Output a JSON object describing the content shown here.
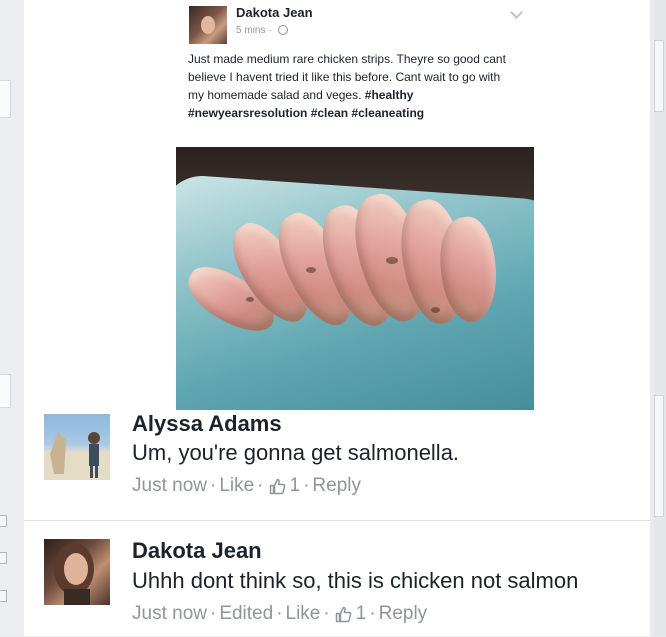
{
  "post": {
    "author": "Dakota Jean",
    "time": "5 mins",
    "text_plain": "Just made medium rare chicken strips. Theyre so good cant believe I havent tried it like this before. Cant wait to go with my homemade salad and veges.",
    "hashtags": "#healthy #newyearsresolution #clean #cleaneating",
    "photo": "medium-rare-chicken-strips"
  },
  "comments": [
    {
      "author": "Alyssa Adams",
      "text": "Um, you're gonna get salmonella.",
      "time": "Just now",
      "edited": "",
      "like_label": "Like",
      "like_count": "1",
      "reply_label": "Reply"
    },
    {
      "author": "Dakota Jean",
      "text": "Uhhh dont think so, this is chicken not salmon",
      "time": "Just now",
      "edited": "Edited",
      "like_label": "Like",
      "like_count": "1",
      "reply_label": "Reply"
    }
  ],
  "icons": {
    "like": "thumbs-up-icon",
    "globe": "globe-icon",
    "menu": "chevron-down-icon"
  },
  "colors": {
    "text": "#1d2129",
    "meta": "#90949c",
    "background": "#e9ebee"
  }
}
